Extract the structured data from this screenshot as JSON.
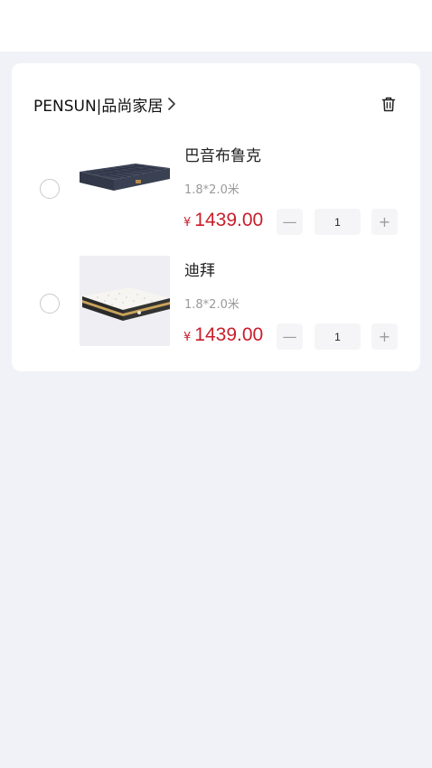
{
  "shop": {
    "name": "PENSUN|品尚家居"
  },
  "colors": {
    "price": "#c81e2b",
    "page_bg": "#f1f2f7",
    "card_bg": "#ffffff"
  },
  "items": [
    {
      "title": "巴音布鲁克",
      "spec": "1.8*2.0米",
      "currency": "¥",
      "price": "1439.00",
      "quantity": "1",
      "minus_label": "—",
      "plus_label": "+",
      "image_icon": "dark-mattress-image"
    },
    {
      "title": "迪拜",
      "spec": "1.8*2.0米",
      "currency": "¥",
      "price": "1439.00",
      "quantity": "1",
      "minus_label": "—",
      "plus_label": "+",
      "image_icon": "white-mattress-image"
    }
  ]
}
